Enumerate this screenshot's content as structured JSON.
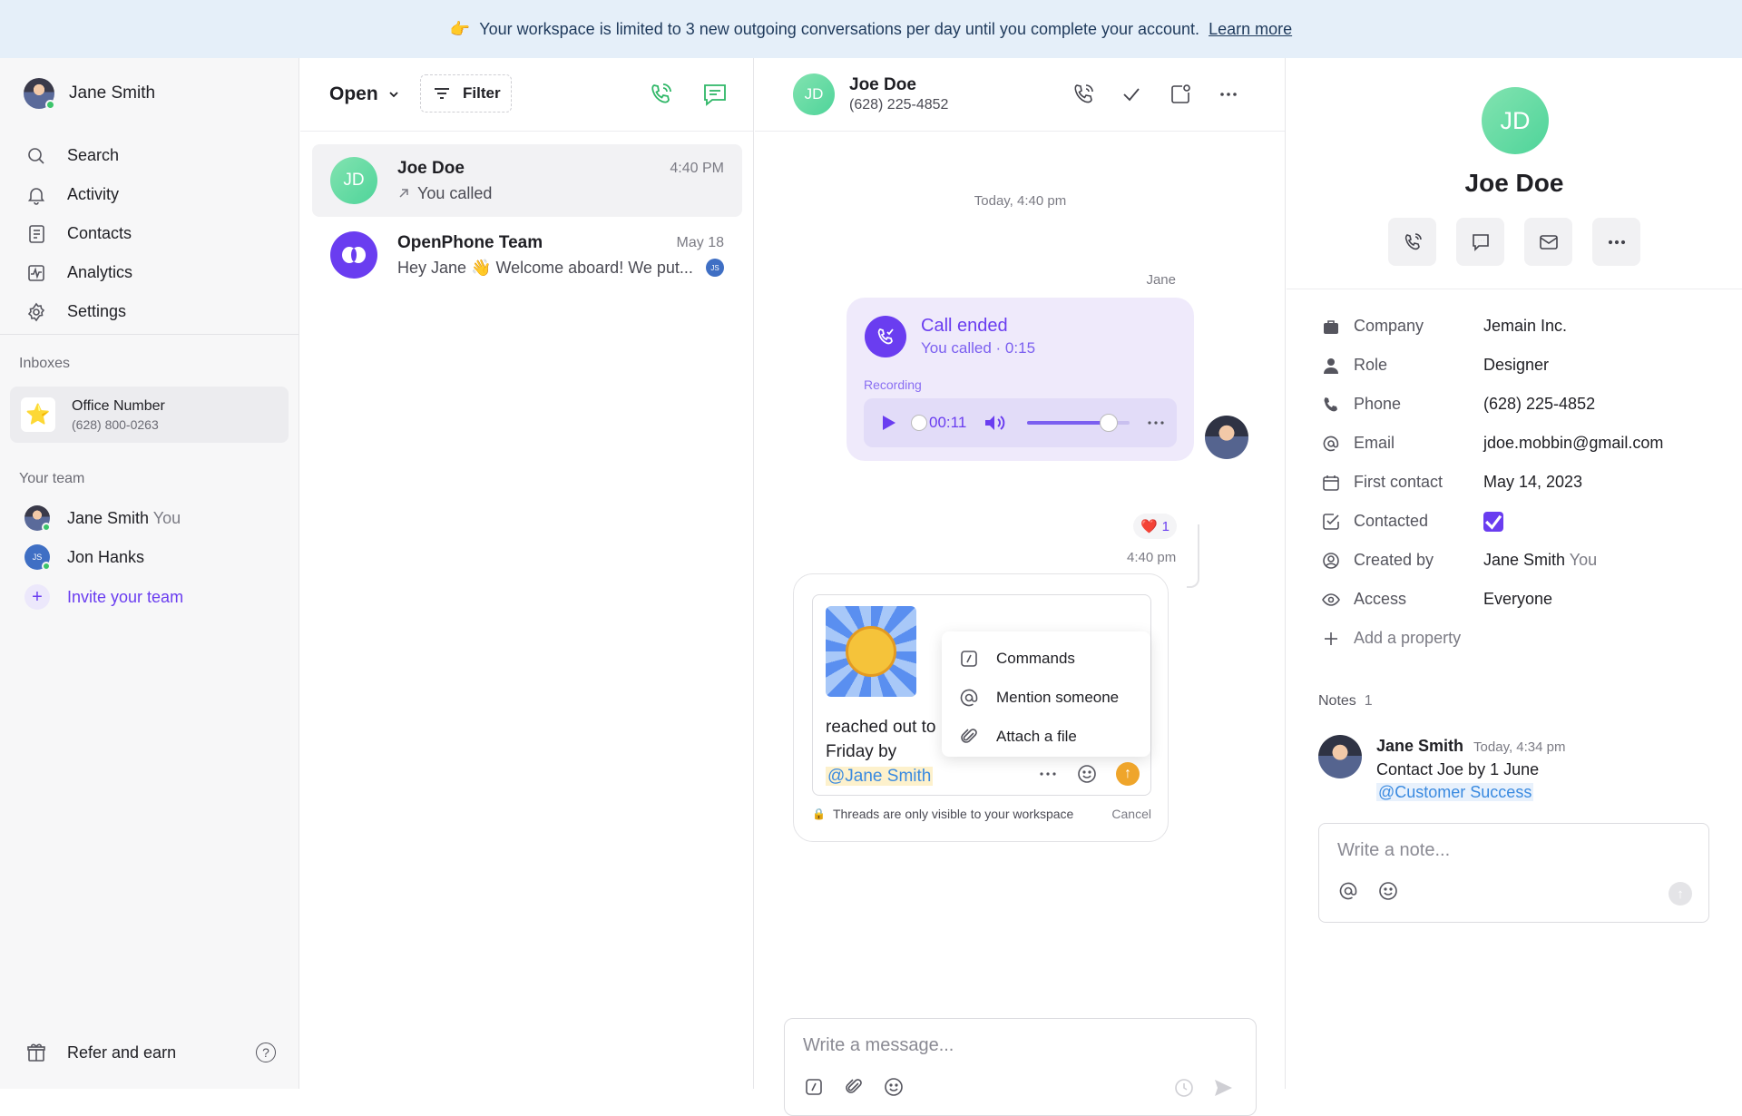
{
  "banner": {
    "emoji": "👉",
    "text": "Your workspace is limited to 3 new outgoing conversations per day until you complete your account.",
    "link": "Learn more"
  },
  "sidebar": {
    "user_name": "Jane Smith",
    "nav": [
      {
        "label": "Search",
        "icon": "search-icon"
      },
      {
        "label": "Activity",
        "icon": "bell-icon"
      },
      {
        "label": "Contacts",
        "icon": "contacts-icon"
      },
      {
        "label": "Analytics",
        "icon": "analytics-icon"
      },
      {
        "label": "Settings",
        "icon": "gear-icon"
      }
    ],
    "inboxes_label": "Inboxes",
    "inbox": {
      "icon": "⭐",
      "name": "Office Number",
      "number": "(628) 800-0263"
    },
    "team_label": "Your team",
    "team": [
      {
        "name": "Jane Smith",
        "tag": "You"
      },
      {
        "name": "Jon Hanks",
        "tag": "",
        "initials": "JS"
      }
    ],
    "invite_label": "Invite your team",
    "refer_label": "Refer and earn"
  },
  "conversations": {
    "status_filter": "Open",
    "filter_label": "Filter",
    "items": [
      {
        "initials": "JD",
        "name": "Joe Doe",
        "time": "4:40 PM",
        "preview": "You called",
        "preview_icon": "outgoing-arrow-icon"
      },
      {
        "name": "OpenPhone Team",
        "time": "May 18",
        "preview": "Hey Jane 👋 Welcome aboard! We put...",
        "badge": "JS"
      }
    ]
  },
  "chat": {
    "contact_initials": "JD",
    "contact_name": "Joe Doe",
    "contact_phone": "(628) 225-4852",
    "date_stamp": "Today, 4:40 pm",
    "sender": "Jane",
    "call": {
      "title": "Call ended",
      "subtitle": "You called · 0:15",
      "recording_label": "Recording",
      "playback_time": "00:11",
      "volume_level": 0.8
    },
    "reaction": {
      "emoji": "❤️",
      "count": "1"
    },
    "message_time": "4:40 pm",
    "thread": {
      "draft_line1": "reached out to",
      "draft_line2": "Friday by",
      "mention": "@Jane Smith",
      "menu": [
        {
          "label": "Commands",
          "icon": "slash-icon"
        },
        {
          "label": "Mention someone",
          "icon": "at-icon"
        },
        {
          "label": "Attach a file",
          "icon": "paperclip-icon"
        }
      ],
      "footer_icon": "🔒",
      "footer_text": "Threads are only visible to your workspace",
      "cancel_label": "Cancel"
    },
    "composer_placeholder": "Write a message..."
  },
  "contact_panel": {
    "initials": "JD",
    "name": "Joe Doe",
    "properties": [
      {
        "icon": "briefcase-icon",
        "key": "Company",
        "value": "Jemain Inc."
      },
      {
        "icon": "person-icon",
        "key": "Role",
        "value": "Designer"
      },
      {
        "icon": "phone-icon",
        "key": "Phone",
        "value": "(628) 225-4852"
      },
      {
        "icon": "at-icon",
        "key": "Email",
        "value": "jdoe.mobbin@gmail.com"
      },
      {
        "icon": "calendar-icon",
        "key": "First contact",
        "value": "May 14, 2023"
      },
      {
        "icon": "check-square-icon",
        "key": "Contacted",
        "checked": true
      },
      {
        "icon": "user-circle-icon",
        "key": "Created by",
        "value": "Jane Smith",
        "suffix": "You"
      },
      {
        "icon": "eye-icon",
        "key": "Access",
        "value": "Everyone"
      }
    ],
    "add_property_label": "Add a property",
    "notes_label": "Notes",
    "notes_count": "1",
    "note": {
      "author": "Jane Smith",
      "time": "Today, 4:34 pm",
      "text": "Contact Joe by 1 June",
      "mention": "@Customer Success"
    },
    "note_placeholder": "Write a note..."
  },
  "colors": {
    "accent": "#6a3df0",
    "banner_bg": "#e5eff9",
    "avatar_green": "#4fd49a",
    "send_orange": "#efa52b"
  }
}
